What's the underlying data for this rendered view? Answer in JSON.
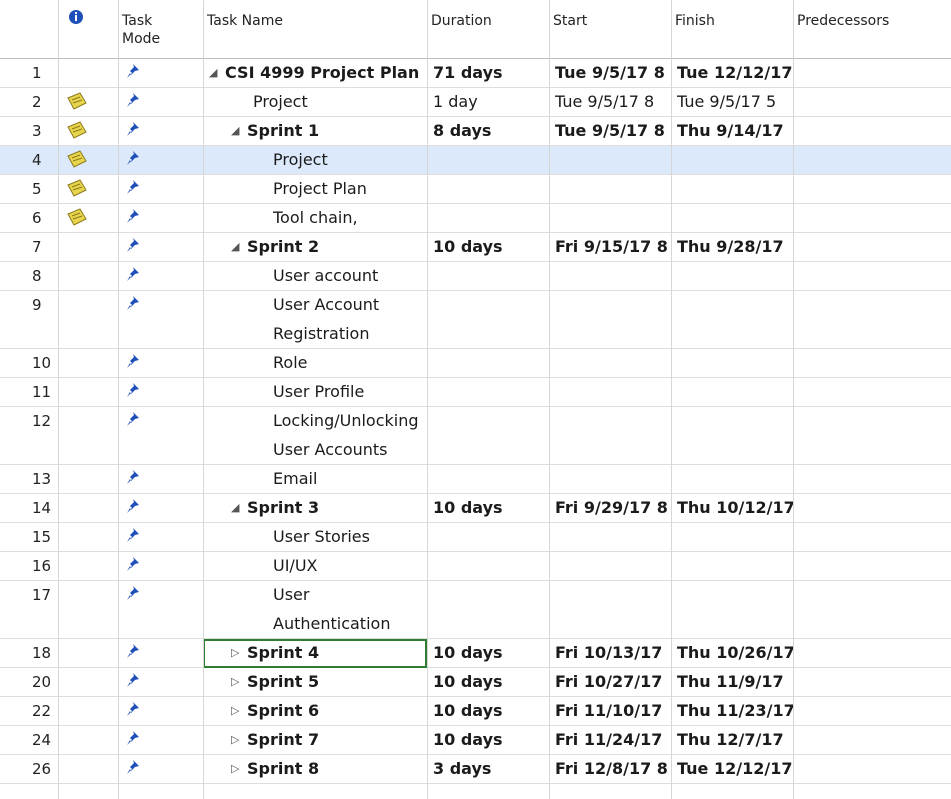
{
  "headers": {
    "info_icon": "i",
    "task_mode": "Task Mode",
    "task_name": "Task Name",
    "duration": "Duration",
    "start": "Start",
    "finish": "Finish",
    "predecessors": "Predecessors"
  },
  "rows": [
    {
      "id": "1",
      "name": "CSI 4999 Project Plan",
      "duration": "71 days",
      "start": "Tue 9/5/17 8",
      "finish": "Tue 12/12/17",
      "summary": true,
      "expanded": true,
      "indent": 0,
      "note": false
    },
    {
      "id": "2",
      "name": "Project",
      "duration": "1 day",
      "start": "Tue 9/5/17 8",
      "finish": "Tue 9/5/17 5",
      "summary": false,
      "indent": 1,
      "note": true
    },
    {
      "id": "3",
      "name": "Sprint 1",
      "duration": "8 days",
      "start": "Tue 9/5/17 8",
      "finish": "Thu 9/14/17",
      "summary": true,
      "expanded": true,
      "indent": 1,
      "note": true
    },
    {
      "id": "4",
      "name": "Project",
      "duration": "",
      "start": "",
      "finish": "",
      "summary": false,
      "indent": 2,
      "note": true,
      "selected": true
    },
    {
      "id": "5",
      "name": "Project Plan",
      "duration": "",
      "start": "",
      "finish": "",
      "summary": false,
      "indent": 2,
      "note": true
    },
    {
      "id": "6",
      "name": "Tool chain,",
      "duration": "",
      "start": "",
      "finish": "",
      "summary": false,
      "indent": 2,
      "note": true
    },
    {
      "id": "7",
      "name": "Sprint 2",
      "duration": "10 days",
      "start": "Fri 9/15/17 8",
      "finish": "Thu 9/28/17",
      "summary": true,
      "expanded": true,
      "indent": 1,
      "note": false
    },
    {
      "id": "8",
      "name": "User account",
      "duration": "",
      "start": "",
      "finish": "",
      "summary": false,
      "indent": 2,
      "note": false
    },
    {
      "id": "9",
      "name": "User Account",
      "name2": "Registration",
      "duration": "",
      "start": "",
      "finish": "",
      "summary": false,
      "indent": 2,
      "note": false
    },
    {
      "id": "10",
      "name": "Role",
      "duration": "",
      "start": "",
      "finish": "",
      "summary": false,
      "indent": 2,
      "note": false
    },
    {
      "id": "11",
      "name": "User Profile",
      "duration": "",
      "start": "",
      "finish": "",
      "summary": false,
      "indent": 2,
      "note": false
    },
    {
      "id": "12",
      "name": "Locking/Unlocking",
      "name2": "User Accounts",
      "duration": "",
      "start": "",
      "finish": "",
      "summary": false,
      "indent": 2,
      "note": false
    },
    {
      "id": "13",
      "name": "Email",
      "duration": "",
      "start": "",
      "finish": "",
      "summary": false,
      "indent": 2,
      "note": false
    },
    {
      "id": "14",
      "name": "Sprint 3",
      "duration": "10 days",
      "start": "Fri 9/29/17 8",
      "finish": "Thu 10/12/17",
      "summary": true,
      "expanded": true,
      "indent": 1,
      "note": false
    },
    {
      "id": "15",
      "name": "User Stories",
      "duration": "",
      "start": "",
      "finish": "",
      "summary": false,
      "indent": 2,
      "note": false
    },
    {
      "id": "16",
      "name": "UI/UX",
      "duration": "",
      "start": "",
      "finish": "",
      "summary": false,
      "indent": 2,
      "note": false
    },
    {
      "id": "17",
      "name": "User",
      "name2": "Authentication",
      "duration": "",
      "start": "",
      "finish": "",
      "summary": false,
      "indent": 2,
      "note": false
    },
    {
      "id": "18",
      "name": "Sprint 4",
      "duration": "10 days",
      "start": "Fri 10/13/17",
      "finish": "Thu 10/26/17",
      "summary": true,
      "expanded": false,
      "indent": 1,
      "note": false,
      "focused": true
    },
    {
      "id": "20",
      "name": "Sprint 5",
      "duration": "10 days",
      "start": "Fri 10/27/17",
      "finish": "Thu 11/9/17",
      "summary": true,
      "expanded": false,
      "indent": 1,
      "note": false
    },
    {
      "id": "22",
      "name": "Sprint 6",
      "duration": "10 days",
      "start": "Fri 11/10/17",
      "finish": "Thu 11/23/17",
      "summary": true,
      "expanded": false,
      "indent": 1,
      "note": false
    },
    {
      "id": "24",
      "name": "Sprint 7",
      "duration": "10 days",
      "start": "Fri 11/24/17",
      "finish": "Thu 12/7/17",
      "summary": true,
      "expanded": false,
      "indent": 1,
      "note": false
    },
    {
      "id": "26",
      "name": "Sprint 8",
      "duration": "3 days",
      "start": "Fri 12/8/17 8",
      "finish": "Tue 12/12/17",
      "summary": true,
      "expanded": false,
      "indent": 1,
      "note": false
    }
  ],
  "colors": {
    "selected_row": "#dbe9fb",
    "focus_border": "#2e7d32",
    "pin": "#1f4fb8",
    "note": "#e8d44d"
  },
  "icons": {
    "pin": "pushpin-icon",
    "note": "note-icon",
    "expand": "triangle-expanded-icon",
    "collapse": "triangle-collapsed-icon",
    "info": "info-icon"
  }
}
